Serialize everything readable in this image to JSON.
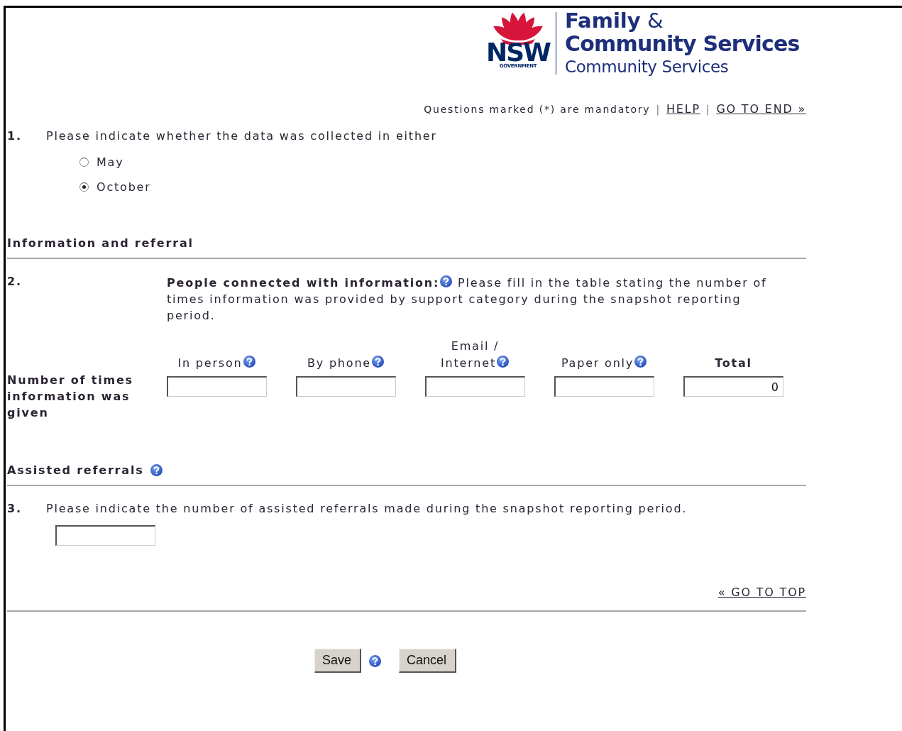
{
  "header": {
    "emblem_text": "NSW",
    "emblem_subtext": "GOVERNMENT",
    "title_word": "Family",
    "title_amp": "&",
    "title_line_2": "Community Services",
    "subtitle": "Community Services"
  },
  "top_links": {
    "note": "Questions marked (*) are mandatory",
    "separator_1": "|",
    "help": "HELP",
    "separator_2": "|",
    "go_to_end": "GO TO END »"
  },
  "question_1": {
    "number": "1.",
    "text": "Please indicate whether the data was collected in either",
    "options": [
      {
        "label": "May",
        "selected": false
      },
      {
        "label": "October",
        "selected": true
      }
    ]
  },
  "section_1": {
    "heading": "Information and referral",
    "help": false
  },
  "question_2": {
    "number": "2.",
    "lead": "People connected with information:",
    "text": "Please fill in the table stating the number of times information was provided by support category during the snapshot reporting period.",
    "row_label": "Number of times information was given",
    "columns": [
      {
        "label": "In person",
        "help": true,
        "kind": "input"
      },
      {
        "label": "By phone",
        "help": true,
        "kind": "input"
      },
      {
        "label": "Email / Internet",
        "help": true,
        "kind": "input"
      },
      {
        "label": "Paper only",
        "help": true,
        "kind": "input"
      },
      {
        "label": "Total",
        "help": false,
        "kind": "total",
        "value": "0"
      }
    ]
  },
  "section_2": {
    "heading": "Assisted referrals",
    "help": true
  },
  "question_3": {
    "number": "3.",
    "text": "Please indicate the number of assisted referrals made during the snapshot reporting period."
  },
  "go_to_top": "« GO TO TOP",
  "buttons": [
    {
      "label": "Save",
      "help": true
    },
    {
      "label": "Cancel",
      "help": false
    }
  ]
}
